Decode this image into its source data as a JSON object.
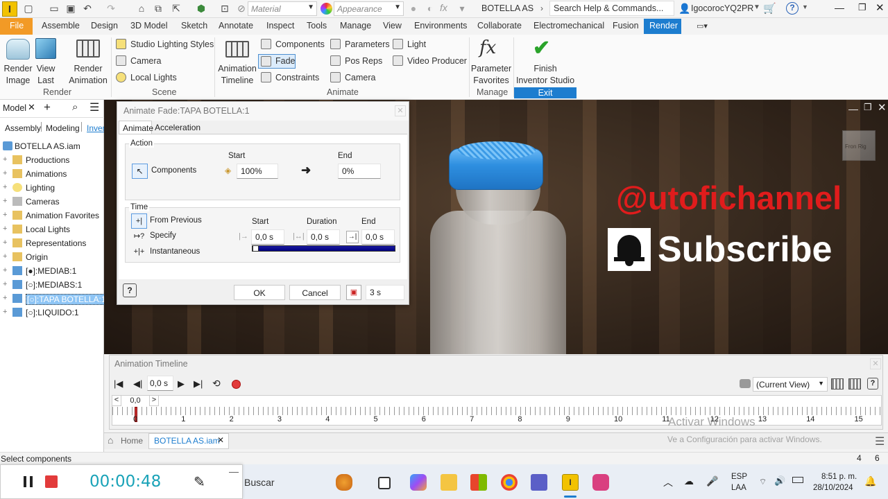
{
  "qat": {
    "material_placeholder": "Material",
    "appearance_placeholder": "Appearance",
    "fx_label": "fx",
    "doc_title": "BOTELLA AS",
    "search_placeholder": "Search Help & Commands...",
    "user": "IgocorocYQ2PR",
    "help_label": "?"
  },
  "menu": {
    "file": "File",
    "items": [
      "Assemble",
      "Design",
      "3D Model",
      "Sketch",
      "Annotate",
      "Inspect",
      "Tools",
      "Manage",
      "View",
      "Environments",
      "Collaborate",
      "Electromechanical",
      "Fusion"
    ],
    "active": "Render"
  },
  "ribbon": {
    "render_image": "Render\nImage",
    "view_last": "View\nLast",
    "render_animation": "Render\nAnimation",
    "render_group": "Render",
    "studio_lighting": "Studio Lighting Styles",
    "camera": "Camera",
    "local_lights": "Local Lights",
    "scene_group": "Scene",
    "animation_timeline": "Animation\nTimeline",
    "components": "Components",
    "fade": "Fade",
    "constraints": "Constraints",
    "parameters": "Parameters",
    "pos_reps": "Pos Reps",
    "camera2": "Camera",
    "light": "Light",
    "video_producer": "Video Producer",
    "animate_group": "Animate",
    "parameter_favorites": "Parameter\nFavorites",
    "manage_group": "Manage",
    "finish": "Finish\nInventor Studio",
    "exit_group": "Exit"
  },
  "browser": {
    "tab_model": "Model",
    "views": [
      "Assembly",
      "Modeling",
      "Inven"
    ],
    "root": "BOTELLA AS.iam",
    "items": [
      {
        "label": "Productions",
        "icon": "folder-icon"
      },
      {
        "label": "Animations",
        "icon": "folder-icon"
      },
      {
        "label": "Lighting",
        "icon": "light-icon"
      },
      {
        "label": "Cameras",
        "icon": "camera-icon"
      },
      {
        "label": "Animation Favorites",
        "icon": "folder-star-icon"
      },
      {
        "label": "Local Lights",
        "icon": "folder-icon"
      },
      {
        "label": "Representations",
        "icon": "folder-icon"
      },
      {
        "label": "Origin",
        "icon": "folder-icon"
      },
      {
        "label": "[●]:MEDIAB:1",
        "icon": "part-icon"
      },
      {
        "label": "[○]:MEDIABS:1",
        "icon": "part-icon"
      },
      {
        "label": "[○]:TAPA BOTELLA:1",
        "icon": "part-icon",
        "selected": true
      },
      {
        "label": "[○]:LIQUIDO:1",
        "icon": "part-icon"
      }
    ]
  },
  "dialog": {
    "title": "Animate Fade:TAPA BOTELLA:1",
    "tabs": [
      "Animate",
      "Acceleration"
    ],
    "action_legend": "Action",
    "components_label": "Components",
    "start_label": "Start",
    "end_label": "End",
    "start_value": "100%",
    "end_value": "0%",
    "time_legend": "Time",
    "from_previous": "From Previous",
    "specify": "Specify",
    "instantaneous": "Instantaneous",
    "time_start_label": "Start",
    "duration_label": "Duration",
    "time_end_label": "End",
    "time_start": "0,0 s",
    "duration": "0,0 s",
    "time_end": "0,0 s",
    "ok": "OK",
    "cancel": "Cancel",
    "total_time": "3 s"
  },
  "viewport": {
    "watermark_channel": "@utofichannel",
    "subscribe": "Subscribe",
    "viewcube_left": "Fron",
    "viewcube_right": "Rig"
  },
  "timeline": {
    "title": "Animation Timeline",
    "time_value": "0,0 s",
    "view_select": "(Current View)",
    "scrub_prev": "<",
    "scrub_value": "0,0",
    "scrub_next": ">",
    "ticks": [
      "0",
      "1",
      "2",
      "3",
      "4",
      "5",
      "6",
      "7",
      "8",
      "9",
      "10",
      "11",
      "12",
      "13",
      "14",
      "15"
    ],
    "activate_title": "Activar Windows",
    "activate_sub": "Ve a Configuración para activar Windows."
  },
  "doctabs": {
    "home": "Home",
    "doc": "BOTELLA AS.iam"
  },
  "status": {
    "message": "Select components",
    "n1": "4",
    "n2": "6"
  },
  "recorder": {
    "elapsed": "00:00:48"
  },
  "taskbar": {
    "search": "Buscar",
    "lang1": "ESP",
    "lang2": "LAA",
    "time": "8:51 p. m.",
    "date": "28/10/2024"
  },
  "colors": {
    "accent": "#1d7dcf",
    "file_tab": "#f29a26",
    "cap_blue": "#2e8fe0",
    "watermark_red": "#e01c1c",
    "record_red": "#e23b3b",
    "timer_teal": "#1aa3b8"
  }
}
